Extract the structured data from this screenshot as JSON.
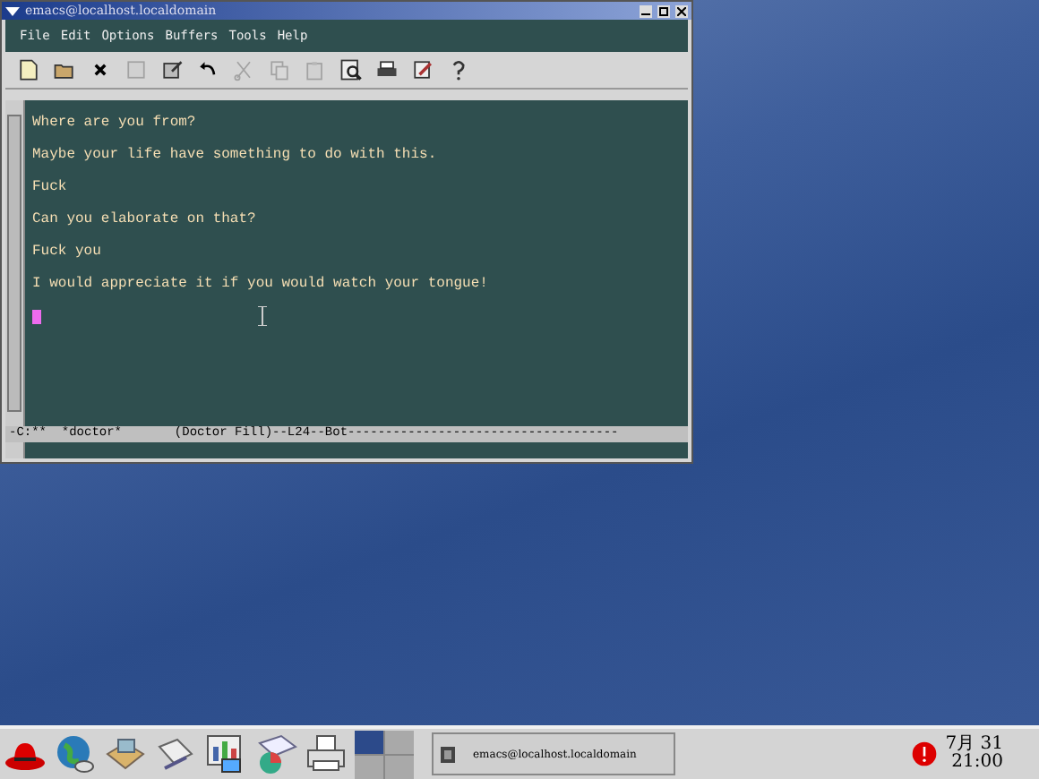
{
  "window": {
    "title": "emacs@localhost.localdomain"
  },
  "menu": [
    "File",
    "Edit",
    "Options",
    "Buffers",
    "Tools",
    "Help"
  ],
  "toolbar": [
    {
      "kind": "new",
      "disabled": false
    },
    {
      "kind": "open",
      "disabled": false
    },
    {
      "kind": "close",
      "disabled": false
    },
    {
      "kind": "save",
      "disabled": true
    },
    {
      "kind": "save-as",
      "disabled": false
    },
    {
      "kind": "undo",
      "disabled": false
    },
    {
      "kind": "cut",
      "disabled": true
    },
    {
      "kind": "copy",
      "disabled": true
    },
    {
      "kind": "paste",
      "disabled": true
    },
    {
      "kind": "search",
      "disabled": false
    },
    {
      "kind": "print",
      "disabled": false
    },
    {
      "kind": "customize",
      "disabled": false
    },
    {
      "kind": "help",
      "disabled": false
    }
  ],
  "buffer": {
    "lines": [
      "Where are you from?",
      "Maybe your life have something to do with this.",
      "Fuck",
      "Can you elaborate on that?",
      "Fuck you",
      "I would appreciate it if you would watch your tongue!"
    ],
    "cursor": true
  },
  "mode_line": "-C:**  *doctor*       (Doctor Fill)--L24--Bot------------------------------------",
  "taskbar": {
    "workspaces": [
      {
        "selected": true
      },
      {
        "selected": false
      },
      {
        "selected": false
      },
      {
        "selected": false
      }
    ],
    "tasks": [
      {
        "title": "emacs@localhost.localdomain",
        "selected": false
      }
    ],
    "clock": {
      "date": "7月 31",
      "time": "21:00"
    }
  }
}
